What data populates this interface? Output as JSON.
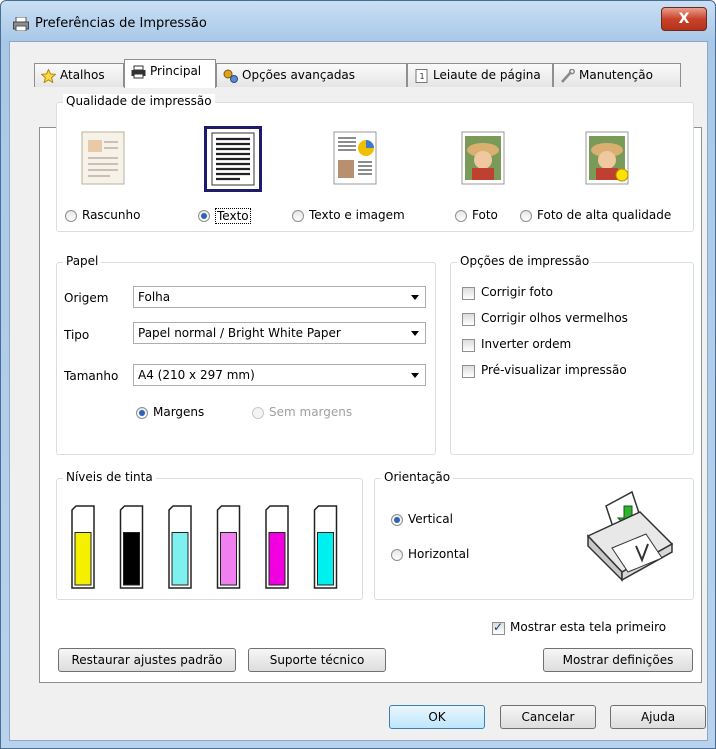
{
  "window": {
    "title": "Preferências de Impressão",
    "close_symbol": "X"
  },
  "tabs": [
    {
      "label": "Atalhos",
      "icon": "star-icon"
    },
    {
      "label": "Principal",
      "icon": "printer-icon"
    },
    {
      "label": "Opções avançadas",
      "icon": "gears-icon"
    },
    {
      "label": "Leiaute de página",
      "icon": "page-number-icon"
    },
    {
      "label": "Manutenção",
      "icon": "wrench-icon"
    }
  ],
  "quality": {
    "title": "Qualidade de impressão",
    "options": [
      {
        "label": "Rascunho",
        "selected": false
      },
      {
        "label": "Texto",
        "selected": true
      },
      {
        "label": "Texto e imagem",
        "selected": false
      },
      {
        "label": "Foto",
        "selected": false
      },
      {
        "label": "Foto de alta qualidade",
        "selected": false
      }
    ]
  },
  "paper": {
    "title": "Papel",
    "source_label": "Origem",
    "source_value": "Folha",
    "type_label": "Tipo",
    "type_value": "Papel normal / Bright White Paper",
    "size_label": "Tamanho",
    "size_value": "A4 (210 x 297 mm)",
    "margins_label": "Margens",
    "margins_selected": true,
    "borderless_label": "Sem margens",
    "borderless_enabled": false
  },
  "print_options": {
    "title": "Opções de impressão",
    "items": [
      {
        "label": "Corrigir foto",
        "checked": false
      },
      {
        "label": "Corrigir olhos vermelhos",
        "checked": false
      },
      {
        "label": "Inverter ordem",
        "checked": false
      },
      {
        "label": "Pré-visualizar impressão",
        "checked": false
      }
    ]
  },
  "ink": {
    "title": "Níveis de tinta",
    "cartridges": [
      {
        "color": "#f5f000",
        "level": 0.75
      },
      {
        "color": "#000000",
        "level": 0.75
      },
      {
        "color": "#7ff0f0",
        "level": 0.75
      },
      {
        "color": "#f080f0",
        "level": 0.75
      },
      {
        "color": "#f000e0",
        "level": 0.75
      },
      {
        "color": "#00f0f0",
        "level": 0.75
      }
    ]
  },
  "orientation": {
    "title": "Orientação",
    "portrait_label": "Vertical",
    "portrait_selected": true,
    "landscape_label": "Horizontal",
    "landscape_selected": false
  },
  "show_first_label": "Mostrar esta tela primeiro",
  "show_first_checked": true,
  "buttons": {
    "restore": "Restaurar ajustes padrão",
    "support": "Suporte técnico",
    "show_settings": "Mostrar definições",
    "ok": "OK",
    "cancel": "Cancelar",
    "help": "Ajuda"
  }
}
